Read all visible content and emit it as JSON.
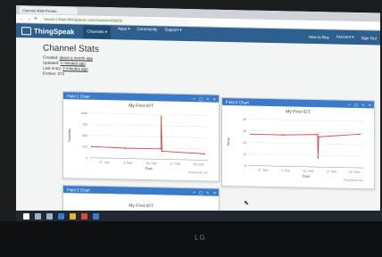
{
  "browser": {
    "tab_title": "Channel 4060 Private...",
    "url": "Secure | https://thingspeak.com/channels/466628"
  },
  "nav": {
    "brand": "ThingSpeak",
    "items": [
      "Channels ▾",
      "Apps ▾",
      "Community",
      "Support ▾"
    ],
    "right_items": [
      "How to Buy",
      "Account ▾",
      "Sign Out"
    ]
  },
  "page": {
    "title": "Channel Stats",
    "meta": [
      {
        "label": "Created:",
        "value": "about a month ago"
      },
      {
        "label": "Updated:",
        "value": "2 minutes ago"
      },
      {
        "label": "Last entry:",
        "value": "2 minutes ago"
      },
      {
        "label": "Entries:",
        "value": "373"
      }
    ]
  },
  "panels": [
    {
      "header": "Field 1 Chart",
      "title": "My First IOT",
      "ylabel": "Humidity",
      "xlabel": "Date",
      "credit": "ThingSpeak.com"
    },
    {
      "header": "Field 2 Chart",
      "title": "My First IOT",
      "ylabel": "Temp",
      "xlabel": "Date",
      "credit": "ThingSpeak.com"
    },
    {
      "header": "Field 3 Chart",
      "title": "My First IOT"
    }
  ],
  "chart_data": [
    {
      "type": "line",
      "title": "My First IOT",
      "xlabel": "Date",
      "ylabel": "Humidity",
      "categories": [
        "27. Jan",
        "3. Feb",
        "10. Feb",
        "17. Feb",
        "24. Feb"
      ],
      "ylim": [
        0,
        1000
      ],
      "yticks": [
        0,
        250,
        500,
        750,
        1000
      ],
      "series": [
        {
          "values": [
            250,
            230,
            230,
            950,
            180,
            140
          ]
        }
      ]
    },
    {
      "type": "line",
      "title": "My First IOT",
      "xlabel": "Date",
      "ylabel": "Temp",
      "categories": [
        "27. Jan",
        "3. Feb",
        "10. Feb",
        "17. Feb",
        "24. Feb"
      ],
      "ylim": [
        0,
        40
      ],
      "yticks": [
        0,
        10,
        20,
        30,
        40
      ],
      "series": [
        {
          "values": [
            27,
            27,
            28,
            8,
            26,
            29
          ]
        }
      ]
    }
  ],
  "taskbar": {
    "icons": [
      {
        "name": "windows-start-icon",
        "color": "#ffffff"
      },
      {
        "name": "search-icon",
        "color": "#9fb3c8"
      },
      {
        "name": "task-view-icon",
        "color": "#9fb3c8"
      },
      {
        "name": "edge-icon",
        "color": "#2f7fd1"
      },
      {
        "name": "explorer-icon",
        "color": "#e8b23a"
      },
      {
        "name": "chrome-icon",
        "color": "#d94a3d"
      },
      {
        "name": "store-icon",
        "color": "#3b7ac8"
      }
    ]
  },
  "monitor_brand": "LG",
  "colors": {
    "nav": "#2d5f8f",
    "panel_header": "#3b7ac8",
    "line": "#d03a3a"
  }
}
